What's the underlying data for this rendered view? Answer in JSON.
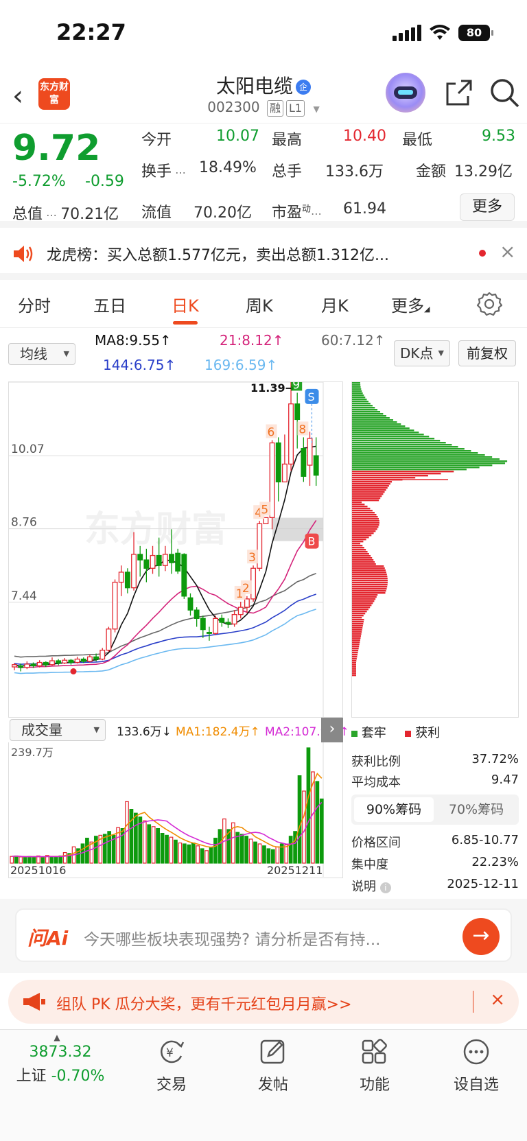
{
  "status": {
    "time": "22:27",
    "battery": "80"
  },
  "header": {
    "logo_text": "东方财富",
    "title": "太阳电缆",
    "code": "002300",
    "tag_margin": "融",
    "tag_level": "L1"
  },
  "quote": {
    "price": "9.72",
    "change_pct": "-5.72%",
    "change": "-0.59",
    "open_label": "今开",
    "open": "10.07",
    "high_label": "最高",
    "high": "10.40",
    "low_label": "最低",
    "low": "9.53",
    "turnover_label": "换手",
    "turnover": "18.49%",
    "volume_label": "总手",
    "volume": "133.6万",
    "amount_label": "金额",
    "amount": "13.29亿",
    "total_value_label": "总值",
    "total_value": "70.21亿",
    "float_value_label": "流值",
    "float_value": "70.20亿",
    "pe_label": "市盈",
    "pe_sup": "动",
    "pe": "61.94",
    "more": "更多"
  },
  "dragon_tiger": {
    "text": "龙虎榜：买入总额1.577亿元，卖出总额1.312亿..."
  },
  "tabs": [
    "分时",
    "五日",
    "日K",
    "周K",
    "月K",
    "更多"
  ],
  "active_tab": "日K",
  "ma": {
    "selector": "均线",
    "ma8": "MA8:9.55↑",
    "ma21": "21:8.12↑",
    "ma60": "60:7.12↑",
    "ma144": "144:6.75↑",
    "ma169": "169:6.59↑",
    "dk_button": "DK点",
    "adjust_button": "前复权",
    "colors": {
      "ma8": "#111111",
      "ma21": "#d4237a",
      "ma60": "#666666",
      "ma144": "#2a3fc9",
      "ma169": "#6ab8f0"
    }
  },
  "kchart": {
    "y_labels": [
      "11.39",
      "10.07",
      "8.76",
      "7.44"
    ],
    "high_marker": "11.39→",
    "watermark": "东方财富",
    "signal_s": "S",
    "signal_b": "B",
    "count_labels": [
      "1",
      "2",
      "3",
      "4",
      "5",
      "6",
      "7",
      "8",
      "9"
    ],
    "candles": [
      [
        6.28,
        6.32,
        6.22,
        6.35
      ],
      [
        6.3,
        6.27,
        6.2,
        6.34
      ],
      [
        6.27,
        6.33,
        6.24,
        6.38
      ],
      [
        6.33,
        6.3,
        6.26,
        6.36
      ],
      [
        6.3,
        6.36,
        6.27,
        6.4
      ],
      [
        6.36,
        6.32,
        6.28,
        6.38
      ],
      [
        6.32,
        6.39,
        6.3,
        6.45
      ],
      [
        6.39,
        6.35,
        6.31,
        6.42
      ],
      [
        6.35,
        6.4,
        6.33,
        6.44
      ],
      [
        6.4,
        6.36,
        6.32,
        6.42
      ],
      [
        6.36,
        6.42,
        6.34,
        6.46
      ],
      [
        6.42,
        6.38,
        6.35,
        6.45
      ],
      [
        6.38,
        6.46,
        6.36,
        6.5
      ],
      [
        6.46,
        6.42,
        6.38,
        6.52
      ],
      [
        6.42,
        6.58,
        6.4,
        6.62
      ],
      [
        6.58,
        6.96,
        6.55,
        7.0
      ],
      [
        6.96,
        7.8,
        6.9,
        7.85
      ],
      [
        7.8,
        7.98,
        7.55,
        8.1
      ],
      [
        7.98,
        7.7,
        7.6,
        8.05
      ],
      [
        7.7,
        8.3,
        7.65,
        8.7
      ],
      [
        8.3,
        8.2,
        7.9,
        8.45
      ],
      [
        8.2,
        8.05,
        7.8,
        8.4
      ],
      [
        8.05,
        8.28,
        7.95,
        8.45
      ],
      [
        8.28,
        8.1,
        7.9,
        8.6
      ],
      [
        8.1,
        8.3,
        8.0,
        8.45
      ],
      [
        8.3,
        8.15,
        7.95,
        8.75
      ],
      [
        8.32,
        8.0,
        7.95,
        8.4
      ],
      [
        8.3,
        7.55,
        7.5,
        8.32
      ],
      [
        7.52,
        7.3,
        7.2,
        7.6
      ],
      [
        7.3,
        7.15,
        7.0,
        7.35
      ],
      [
        7.15,
        6.95,
        6.8,
        7.2
      ],
      [
        6.9,
        6.88,
        6.75,
        7.0
      ],
      [
        6.88,
        7.15,
        6.85,
        7.2
      ],
      [
        7.15,
        7.08,
        7.0,
        7.22
      ],
      [
        7.08,
        7.05,
        6.98,
        7.15
      ],
      [
        7.05,
        7.22,
        7.0,
        7.3
      ],
      [
        7.22,
        7.35,
        7.15,
        7.45
      ],
      [
        7.35,
        7.5,
        7.25,
        7.55
      ],
      [
        7.5,
        8.05,
        7.45,
        8.1
      ],
      [
        8.05,
        8.85,
        8.0,
        8.9
      ],
      [
        8.85,
        8.96,
        8.9,
        8.96
      ],
      [
        8.96,
        10.3,
        8.75,
        10.35
      ],
      [
        10.3,
        9.6,
        9.25,
        10.4
      ],
      [
        9.6,
        9.92,
        9.6,
        10.45
      ],
      [
        9.92,
        11.0,
        9.8,
        11.39
      ],
      [
        11.0,
        10.72,
        10.2,
        11.2
      ],
      [
        10.2,
        9.7,
        9.6,
        10.4
      ],
      [
        9.9,
        10.38,
        9.53,
        10.5
      ],
      [
        10.07,
        9.72,
        9.53,
        10.4
      ]
    ]
  },
  "volume": {
    "selector": "成交量",
    "vol": "133.6万↓",
    "ma1": "MA1:182.4万↑",
    "ma2": "MA2:107.9万↑",
    "max_label": "239.7万",
    "date_start": "20251016",
    "date_end": "20251211",
    "values": [
      14,
      15,
      13,
      12,
      14,
      13,
      15,
      12,
      16,
      14,
      13,
      15,
      22,
      20,
      34,
      30,
      40,
      52,
      44,
      56,
      58,
      60,
      66,
      58,
      74,
      72,
      128,
      112,
      104,
      96,
      88,
      80,
      76,
      72,
      62,
      58,
      54,
      48,
      42,
      40,
      38,
      42,
      36,
      30,
      26,
      32,
      52,
      70,
      92,
      70,
      84,
      64,
      60,
      56,
      50,
      44,
      40,
      36,
      30,
      28,
      34,
      40,
      38,
      56,
      66,
      182,
      150,
      240,
      190,
      170,
      133.6
    ],
    "colors": {
      "ma1": "#f08c00",
      "ma2": "#d42ad4"
    }
  },
  "chips": {
    "legend_trapped": "套牢",
    "legend_profit": "获利",
    "profit_ratio_label": "获利比例",
    "profit_ratio": "37.72%",
    "avg_cost_label": "平均成本",
    "avg_cost": "9.47",
    "tab_90": "90%筹码",
    "tab_70": "70%筹码",
    "range_label": "价格区间",
    "range": "6.85-10.77",
    "concentration_label": "集中度",
    "concentration": "22.23%",
    "note_label": "说明",
    "date": "2025-12-11"
  },
  "ai": {
    "logo": "问Ai",
    "placeholder": "今天哪些板块表现强势? 请分析是否有持..."
  },
  "promo": {
    "text": "组队 PK 瓜分大奖，更有千元红包月月赢>>"
  },
  "bottom_nav": {
    "index_value": "3873.32",
    "index_name": "上证",
    "index_change": "-0.70%",
    "trade": "交易",
    "post": "发帖",
    "function": "功能",
    "watchlist": "设自选"
  }
}
